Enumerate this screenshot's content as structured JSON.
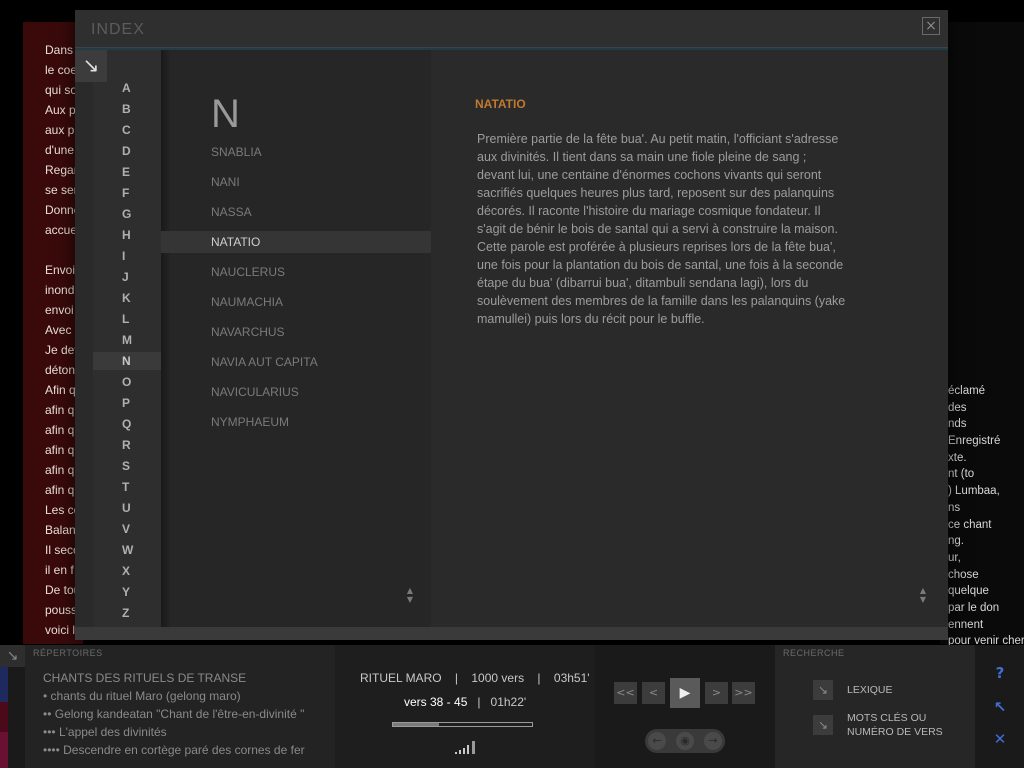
{
  "background": {
    "left_text_lines": [
      "Dans s",
      "le coe",
      "qui so",
      "Aux pi",
      "aux pr",
      "d'une",
      "Regar",
      "se ser",
      "Donne",
      "accue",
      "",
      "Envoi",
      "inond",
      "envoi",
      "Avec l",
      "Je dev",
      "déton",
      "Afin q",
      "afin q",
      "afin q",
      "afin q",
      "afin q",
      "afin q",
      "Les co",
      "Balan",
      "Il seco",
      "il en f",
      "De tou",
      "pouss",
      "voici l"
    ],
    "right_text_lines": [
      "éclamé",
      "des",
      "nds",
      " Enregistré",
      "xte.",
      "nt (to",
      ") Lumbaa,",
      "ns",
      "ce chant",
      "ng.",
      "ur,",
      "chose",
      " quelque",
      " par le don",
      "ennent",
      "pour venir chercher cette"
    ]
  },
  "modal": {
    "title": "INDEX",
    "close_symbol": "×",
    "corner_arrow": "↘",
    "alphabet": [
      "A",
      "B",
      "C",
      "D",
      "E",
      "F",
      "G",
      "H",
      "I",
      "J",
      "K",
      "L",
      "M",
      "N",
      "O",
      "P",
      "Q",
      "R",
      "S",
      "T",
      "U",
      "V",
      "W",
      "X",
      "Y",
      "Z"
    ],
    "active_letter": "N",
    "current_letter": "N",
    "entries": [
      "SNABLIA",
      "NANI",
      "NASSA",
      "NATATIO",
      "NAUCLERUS",
      "NAUMACHIA",
      "NAVARCHUS",
      "NAVIA AUT CAPITA",
      "NAVICULARIUS",
      "NYMPHAEUM"
    ],
    "active_entry": "NATATIO",
    "scroll_up": "▲",
    "scroll_down": "▼",
    "detail": {
      "title": "NATATIO",
      "body": "Première partie de la fête bua'. Au petit matin, l'officiant s'adresse aux divinités. Il tient dans sa main une fiole pleine de sang ; devant lui, une centaine d'énormes cochons vivants qui seront sacrifiés quelques heures plus tard, reposent sur des palanquins décorés. Il raconte l'histoire du mariage cosmique fondateur. Il s'agit de bénir le bois de santal qui a servi à construire la maison.\nCette parole est proférée  à plusieurs reprises lors de la fête bua', une fois pour la plantation du  bois de santal, une fois à la seconde étape du bua' (dibarrui bua', ditambuli sendana lagi), lors du soulèvement des membres de la famille dans les palanquins (yake mamullei) puis lors du récit pour le buffle."
    }
  },
  "bottombar": {
    "corner_icon": "↘",
    "repertoires": {
      "label": "RÉPERTOIRES",
      "lines": [
        "CHANTS DES RITUELS DE TRANSE",
        "• chants du rituel Maro (gelong maro)",
        "•• Gelong kandeatan \"Chant de l'être-en-divinité \"",
        "••• L'appel des divinités",
        "•••• Descendre en cortège paré des cornes de fer"
      ]
    },
    "info": {
      "ritual": "RITUEL MARO",
      "sep": "|",
      "verses_total": "1000 vers",
      "duration": "03h51'",
      "current_verses": "vers 38 - 45",
      "current_time": "01h22'",
      "progress": 0.33
    },
    "controls": {
      "rewind_label": "<<",
      "prev_label": "<",
      "play_label": "▶",
      "next_label": ">",
      "forward_label": ">>",
      "sub_prev": "←",
      "sub_eye": "◉",
      "sub_next": "→"
    },
    "search": {
      "label": "RECHERCHE",
      "lexique": "LEXIQUE",
      "keywords": "MOTS CLÉS OU\nNUMÉRO DE VERS",
      "btn_icon": "↘"
    },
    "side": {
      "help": "?",
      "expand": "↖",
      "close": "✕"
    },
    "colors": {
      "accent_blue": "#3f6fd6",
      "detail_title": "#c07a30"
    }
  }
}
